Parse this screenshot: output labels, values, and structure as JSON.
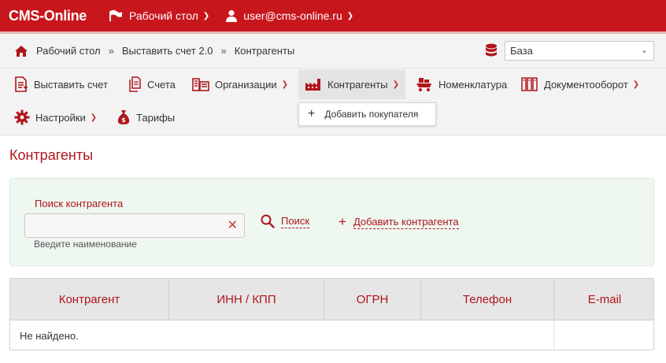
{
  "header": {
    "brand": "CMS-Online",
    "desktop_label": "Рабочий стол",
    "user_label": "user@cms-online.ru"
  },
  "breadcrumbs": {
    "items": [
      "Рабочий стол",
      "Выставить счет 2.0",
      "Контрагенты"
    ],
    "separator": "»"
  },
  "base_select": {
    "value": "База"
  },
  "menu": {
    "items": [
      {
        "label": "Выставить счет",
        "icon": "invoice-icon"
      },
      {
        "label": "Счета",
        "icon": "documents-icon"
      },
      {
        "label": "Организации",
        "icon": "buildings-icon"
      },
      {
        "label": "Контрагенты",
        "icon": "factory-icon"
      },
      {
        "label": "Номенклатура",
        "icon": "cart-icon"
      },
      {
        "label": "Документооборот",
        "icon": "folders-icon"
      },
      {
        "label": "Настройки",
        "icon": "gear-icon"
      },
      {
        "label": "Тарифы",
        "icon": "money-bag-icon"
      }
    ],
    "dropdown_item": "Добавить покупателя"
  },
  "page": {
    "title": "Контрагенты"
  },
  "search": {
    "label": "Поиск контрагента",
    "value": "",
    "hint": "Введите наименование",
    "search_button": "Поиск",
    "add_button": "Добавить контрагента"
  },
  "table": {
    "columns": [
      "Контрагент",
      "ИНН / КПП",
      "ОГРН",
      "Телефон",
      "E-mail"
    ],
    "empty_text": "Не найдено."
  },
  "colors": {
    "accent": "#c8161d",
    "text_red": "#b0151b",
    "panel_green": "#eef7f0"
  }
}
